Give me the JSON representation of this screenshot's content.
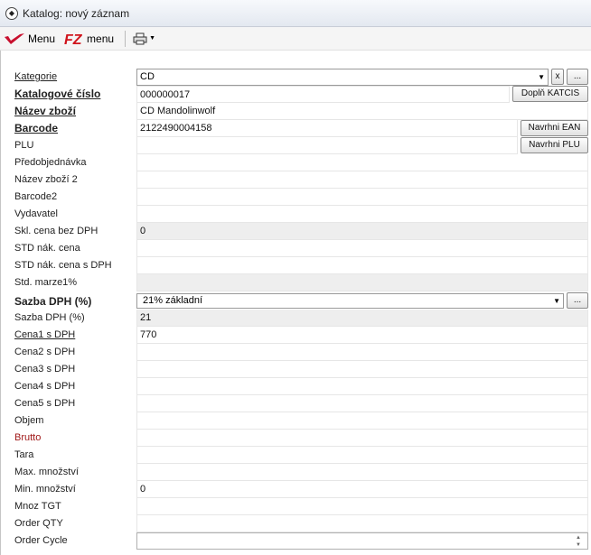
{
  "window": {
    "title": "Katalog: nový záznam"
  },
  "toolbar": {
    "menu1_label": "Menu",
    "menu2_label": "menu"
  },
  "form": {
    "kategorie": {
      "label": "Kategorie",
      "value": "CD",
      "x_btn": "x",
      "more_btn": "..."
    },
    "katalogove_cislo": {
      "label": "Katalogové číslo",
      "value": "000000017",
      "button": "Doplň KATCIS"
    },
    "nazev_zbozi": {
      "label": "Název zboží",
      "value": "CD Mandolinwolf"
    },
    "barcode": {
      "label": "Barcode",
      "value": "2122490004158",
      "button": "Navrhni EAN"
    },
    "plu": {
      "label": "PLU",
      "value": "",
      "button": "Navrhni PLU"
    },
    "predobjednavka": {
      "label": "Předobjednávka",
      "value": ""
    },
    "nazev_zbozi_2": {
      "label": "Název zboží 2",
      "value": ""
    },
    "barcode2": {
      "label": "Barcode2",
      "value": ""
    },
    "vydavatel": {
      "label": "Vydavatel",
      "value": ""
    },
    "skl_cena": {
      "label": "Skl. cena bez DPH",
      "value": "0"
    },
    "std_nak_cena": {
      "label": "STD nák. cena",
      "value": ""
    },
    "std_nak_cena_dph": {
      "label": "STD nák. cena s DPH",
      "value": ""
    },
    "std_marze": {
      "label": "Std. marze1%",
      "value": ""
    },
    "sazba_dph_select": {
      "label": "Sazba DPH (%)",
      "value": "21% základní",
      "more_btn": "..."
    },
    "sazba_dph": {
      "label": "Sazba DPH (%)",
      "value": "21"
    },
    "cena1": {
      "label": "Cena1 s DPH",
      "value": "770"
    },
    "cena2": {
      "label": "Cena2 s DPH",
      "value": ""
    },
    "cena3": {
      "label": "Cena3 s DPH",
      "value": ""
    },
    "cena4": {
      "label": "Cena4 s DPH",
      "value": ""
    },
    "cena5": {
      "label": "Cena5 s DPH",
      "value": ""
    },
    "objem": {
      "label": "Objem",
      "value": ""
    },
    "brutto": {
      "label": "Brutto",
      "value": ""
    },
    "tara": {
      "label": "Tara",
      "value": ""
    },
    "max_mnozstvi": {
      "label": "Max. množství",
      "value": ""
    },
    "min_mnozstvi": {
      "label": "Min. množství",
      "value": "0"
    },
    "mnoz_tgt": {
      "label": "Mnoz TGT",
      "value": ""
    },
    "order_qty": {
      "label": "Order QTY",
      "value": ""
    },
    "order_cycle": {
      "label": "Order Cycle",
      "value": ""
    }
  }
}
